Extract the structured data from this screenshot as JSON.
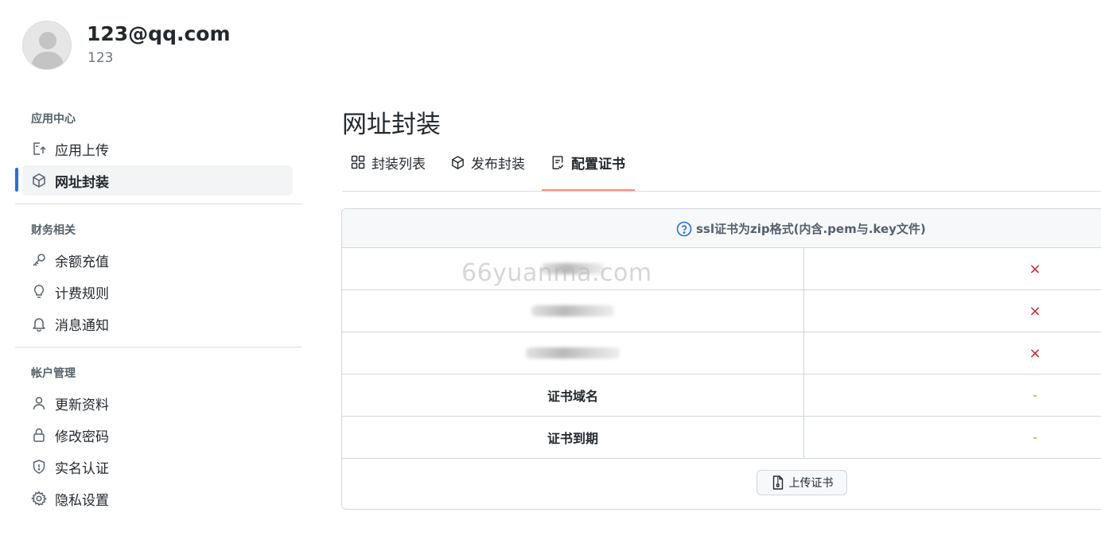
{
  "user": {
    "email": "123@qq.com",
    "name": "123"
  },
  "sidebar": {
    "sections": [
      {
        "title": "应用中心",
        "items": [
          {
            "label": "应用上传",
            "icon": "app-upload-icon"
          },
          {
            "label": "网址封装",
            "icon": "package-icon",
            "active": true
          }
        ]
      },
      {
        "title": "财务相关",
        "items": [
          {
            "label": "余额充值",
            "icon": "key-icon"
          },
          {
            "label": "计费规则",
            "icon": "lightbulb-icon"
          },
          {
            "label": "消息通知",
            "icon": "bell-icon"
          }
        ]
      },
      {
        "title": "帐户管理",
        "items": [
          {
            "label": "更新资料",
            "icon": "person-icon"
          },
          {
            "label": "修改密码",
            "icon": "lock-icon"
          },
          {
            "label": "实名认证",
            "icon": "shield-icon"
          },
          {
            "label": "隐私设置",
            "icon": "gear-icon"
          }
        ]
      }
    ]
  },
  "main": {
    "title": "网址封装",
    "tabs": [
      {
        "label": "封装列表",
        "icon": "grid-icon"
      },
      {
        "label": "发布封装",
        "icon": "package-icon"
      },
      {
        "label": "配置证书",
        "icon": "file-check-icon",
        "active": true
      }
    ],
    "cert_panel": {
      "header": "ssl证书为zip格式(内含.pem与.key文件)",
      "rows": [
        {
          "label": "",
          "value": "×",
          "status": "missing"
        },
        {
          "label": "",
          "value": "×",
          "status": "missing"
        },
        {
          "label": "",
          "value": "×",
          "status": "missing"
        },
        {
          "label": "证书域名",
          "value": "-",
          "status": "empty"
        },
        {
          "label": "证书到期",
          "value": "-",
          "status": "empty"
        }
      ],
      "upload_label": "上传证书"
    }
  },
  "watermark": "66yuanma.com",
  "colors": {
    "accent": "#1f6feb",
    "tab_underline": "#fd8c73",
    "error": "#cf222e",
    "warning": "#bf8700"
  }
}
